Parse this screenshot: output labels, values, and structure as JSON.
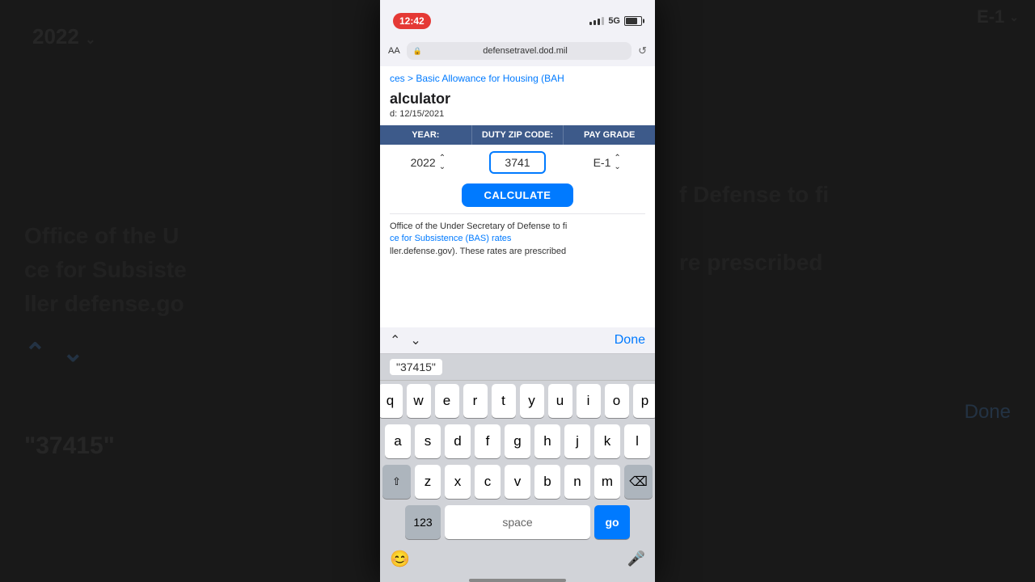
{
  "background": {
    "left": {
      "year_label": "2022",
      "large_text_1": "Office of the U",
      "large_text_2": "ce for Subsiste",
      "large_text_3": "ller defense.go",
      "quote": "\"37415\"",
      "arrows_up": "⌃",
      "arrows_down": "⌄"
    },
    "right": {
      "grade_indicator": "E-1",
      "large_text_1": "f Defense to fi",
      "large_text_2": "",
      "large_text_3": "re prescribed",
      "done_label": "Done"
    }
  },
  "status_bar": {
    "time": "12:42",
    "network": "5G"
  },
  "browser": {
    "aa_label": "AA",
    "url": "defensetravel.dod.mil",
    "refresh_icon": "↺"
  },
  "breadcrumb": {
    "text": "ces > Basic Allowance for Housing (BAH"
  },
  "page": {
    "title": "alculator",
    "updated": "d: 12/15/2021"
  },
  "calculator": {
    "headers": {
      "year": "YEAR:",
      "zip": "DUTY ZIP CODE:",
      "grade": "PAY GRADE"
    },
    "year_value": "2022",
    "zip_value": "3741",
    "grade_value": "E-1",
    "calculate_label": "CALCULATE"
  },
  "body_text": {
    "line1": "Office of the Under Secretary of Defense to fi",
    "link": "ce for Subsistence (BAS) rates",
    "line2": "ller.defense.gov). These rates are prescribed"
  },
  "keyboard_toolbar": {
    "up_arrow": "⌃",
    "down_arrow": "⌄",
    "done": "Done"
  },
  "autocomplete": {
    "suggestion": "\"37415\""
  },
  "keyboard": {
    "row1": [
      "q",
      "w",
      "e",
      "r",
      "t",
      "y",
      "u",
      "i",
      "o",
      "p"
    ],
    "row2": [
      "a",
      "s",
      "d",
      "f",
      "g",
      "h",
      "j",
      "k",
      "l"
    ],
    "row3": [
      "z",
      "x",
      "c",
      "v",
      "b",
      "n",
      "m"
    ],
    "numbers_label": "123",
    "space_label": "space",
    "go_label": "go"
  }
}
